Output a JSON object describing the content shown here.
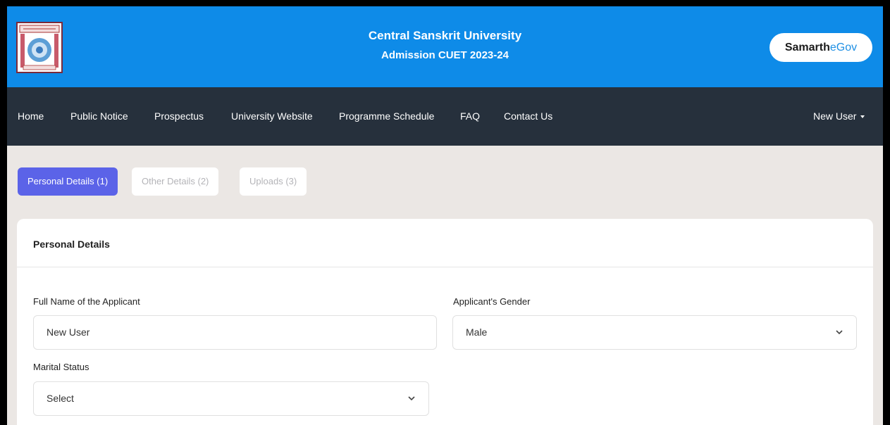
{
  "header": {
    "title": "Central Sanskrit University",
    "subtitle": "Admission CUET 2023-24",
    "brand_part1": "Samarth",
    "brand_part2": "eGov"
  },
  "nav": {
    "items": [
      {
        "label": "Home"
      },
      {
        "label": "Public Notice"
      },
      {
        "label": "Prospectus"
      },
      {
        "label": "University Website"
      },
      {
        "label": "Programme Schedule"
      },
      {
        "label": "FAQ"
      },
      {
        "label": "Contact Us"
      }
    ],
    "user_menu": "New User"
  },
  "steps": [
    {
      "label": "Personal Details",
      "number": "(1)",
      "active": true
    },
    {
      "label": "Other Details",
      "number": "(2)",
      "active": false
    },
    {
      "label": "Uploads",
      "number": "(3)",
      "active": false
    }
  ],
  "form": {
    "section_title": "Personal Details",
    "full_name": {
      "label": "Full Name of the Applicant",
      "value": "New User"
    },
    "gender": {
      "label": "Applicant's Gender",
      "value": "Male"
    },
    "marital_status": {
      "label": "Marital Status",
      "value": "Select"
    }
  },
  "colors": {
    "header_bg": "#0e8be8",
    "nav_bg": "#26303c",
    "step_active": "#5b63e8",
    "page_bg": "#ebe7e4"
  }
}
